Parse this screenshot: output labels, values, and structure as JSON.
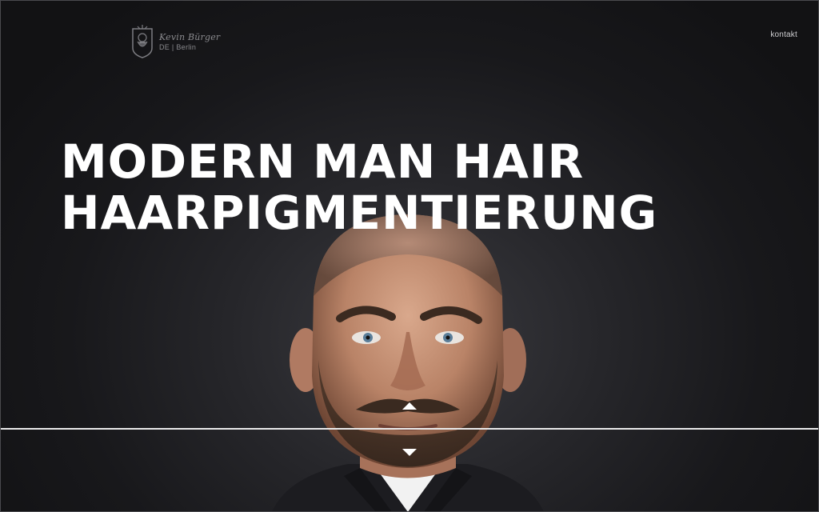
{
  "header": {
    "logo": {
      "name": "Kevin Bürger",
      "location": "DE | Berlin",
      "icon": "bearded-man-crest-icon"
    },
    "nav": {
      "contact_label": "kontakt"
    }
  },
  "hero": {
    "headline_line1": "MODERN MAN HAIR",
    "headline_line2": "HAARPIGMENTIERUNG",
    "image": "bald-man-portrait",
    "slider_prev_icon": "arrow-up-icon",
    "slider_next_icon": "arrow-down-icon"
  },
  "colors": {
    "background": "#18181b",
    "headline": "#ffffff",
    "logo": "#8a8a8e",
    "divider": "#e9e9ea"
  }
}
